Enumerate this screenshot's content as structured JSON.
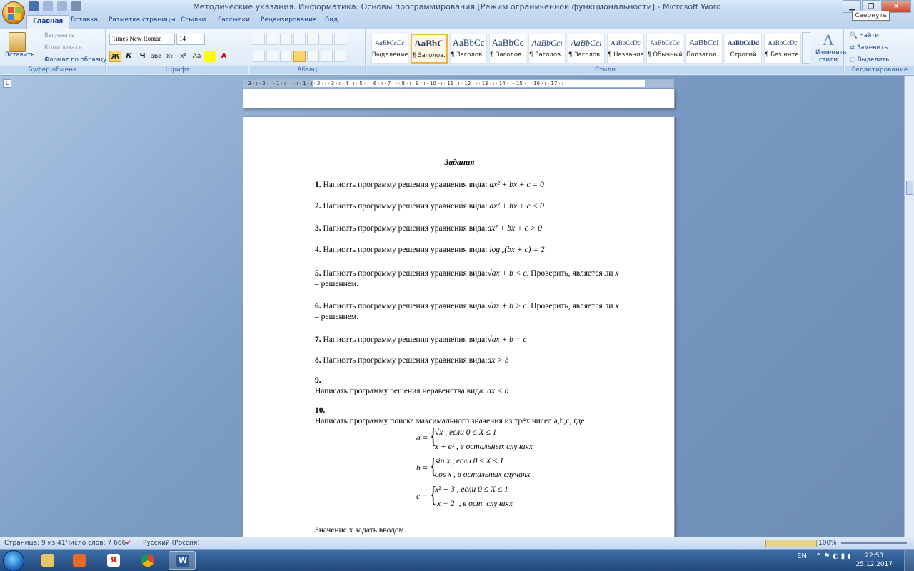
{
  "window": {
    "title": "Методические указания. Информатика. Основы программирования [Режим ограниченной функциональности] - Microsoft Word",
    "tooltip": "Свернуть"
  },
  "tabs": [
    "Главная",
    "Вставка",
    "Разметка страницы",
    "Ссылки",
    "Рассылки",
    "Рецензирование",
    "Вид"
  ],
  "ribbon": {
    "clipboard": {
      "paste": "Вставить",
      "cut": "Вырезать",
      "copy": "Копировать",
      "format_painter": "Формат по образцу",
      "group": "Буфер обмена"
    },
    "font": {
      "name": "Times New Roman",
      "size": "14",
      "group": "Шрифт",
      "bold": "Ж",
      "italic": "К",
      "underline": "Ч",
      "strike": "abe",
      "sub": "x₂",
      "sup": "x²",
      "case": "Aa",
      "color": "A"
    },
    "paragraph": {
      "group": "Абзац"
    },
    "styles": {
      "group": "Стили",
      "items": [
        {
          "sample": "AaBbCcDc",
          "label": "Выделение"
        },
        {
          "sample": "AaBbC",
          "label": "¶ Заголов..."
        },
        {
          "sample": "AaBbCc",
          "label": "¶ Заголов..."
        },
        {
          "sample": "AaBbCc",
          "label": "¶ Заголов..."
        },
        {
          "sample": "AaBbCcı",
          "label": "¶ Заголов..."
        },
        {
          "sample": "AaBbCcı",
          "label": "¶ Заголов..."
        },
        {
          "sample": "AaBbCcDc",
          "label": "¶ Название"
        },
        {
          "sample": "AaBbCcDc",
          "label": "¶ Обычный"
        },
        {
          "sample": "AaBbCcI",
          "label": "Подзагол..."
        },
        {
          "sample": "AaBbCcDd",
          "label": "Строгий"
        },
        {
          "sample": "AaBbCcDc",
          "label": "¶ Без инте..."
        }
      ],
      "change": "Изменить стили"
    },
    "editing": {
      "find": "Найти",
      "replace": "Заменить",
      "select": "Выделить",
      "group": "Редактирование"
    }
  },
  "ruler": "· 3 · ı · 2 · ı · 1 · ı · · · ı · 1 · ı · 2 · ı · 3 · ı · 4 · ı · 5 · ı · 6 · ı · 7 · ı · 8 · ı · 9 · ı · 10 · ı · 11 · ı · 12 · ı · 13 · ı · 14 · ı · 15 · ı · 16 · ı · 17 · ı",
  "document": {
    "heading": "Задания",
    "tasks": [
      {
        "num": "1.",
        "text": "Написать программу решения уравнения вида:",
        "formula": "ax² + bx + c = 0"
      },
      {
        "num": "2.",
        "text": "Написать программу решения уравнения вида:",
        "formula": "ax² + bx + c < 0"
      },
      {
        "num": "3.",
        "text": "Написать программу решения уравнения вида:",
        "formula": "ax² + bx + c > 0"
      },
      {
        "num": "4.",
        "text": "Написать программу решения уравнения вида:",
        "formula": "log ₐ(bx + c) = 2"
      },
      {
        "num": "5.",
        "text": "Написать программу решения уравнения вида:",
        "formula": "√ax + b < c",
        "after": ". Проверить, является ли",
        "var": "x",
        "line2": "– решением."
      },
      {
        "num": "6.",
        "text": "Написать программу решения уравнения вида:",
        "formula": "√ax + b > c",
        "after": ". Проверить, является ли",
        "var": "x",
        "line2": "– решением."
      },
      {
        "num": "7.",
        "text": "Написать программу решения уравнения вида:",
        "formula": "√ax + b = c"
      },
      {
        "num": "8.",
        "text": "Написать программу решения уравнения вида:",
        "formula": "ax > b"
      },
      {
        "num": "9.",
        "text": "Написать программу решения неравенства вида:",
        "formula": "ax < b"
      },
      {
        "num": "10.",
        "text": "Написать программу поиска максимального значения из трёх чисел a,b,c, где"
      }
    ],
    "piecewise": {
      "a_name": "a =",
      "a1": "√x , если 0 ≤ X ≤ 1",
      "a2": "x + eˣ , в остальных случаях",
      "b_name": "b =",
      "b1": "sin x , если 0 ≤ X ≤ 1",
      "b2": "cos x , в остальных случаях   ,",
      "c_name": "c =",
      "c1": "x² + 3 , если 0 ≤ X ≤ 1",
      "c2": "|x − 2| , в ост. случаях"
    },
    "footer_line": "Значение x задать вводом."
  },
  "status": {
    "page": "Страница: 9 из 41",
    "words": "Число слов: 7 666",
    "lang": "Русский (Россия)",
    "zoom": "100%"
  },
  "taskbar": {
    "lang": "EN",
    "time": "22:53",
    "date": "25.12.2017"
  }
}
